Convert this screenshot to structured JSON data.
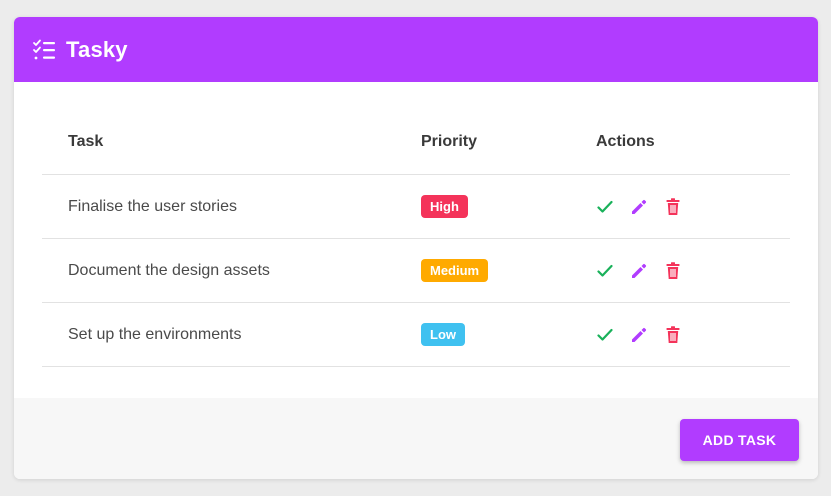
{
  "app": {
    "title": "Tasky",
    "accent_color": "#b13cff",
    "logo_icon": "checklist-icon"
  },
  "table": {
    "headers": {
      "task": "Task",
      "priority": "Priority",
      "actions": "Actions"
    },
    "rows": [
      {
        "task": "Finalise the user stories",
        "priority": "High",
        "priority_color": "#f4335a"
      },
      {
        "task": "Document the design assets",
        "priority": "Medium",
        "priority_color": "#ffaa00"
      },
      {
        "task": "Set up the environments",
        "priority": "Low",
        "priority_color": "#3fc1f0"
      }
    ],
    "action_icons": {
      "complete": {
        "icon": "check-icon",
        "color": "#19b15a"
      },
      "edit": {
        "icon": "pencil-icon",
        "color": "#b13cff"
      },
      "delete": {
        "icon": "trash-icon",
        "color": "#f4335a"
      }
    }
  },
  "footer": {
    "add_button_label": "ADD TASK"
  }
}
